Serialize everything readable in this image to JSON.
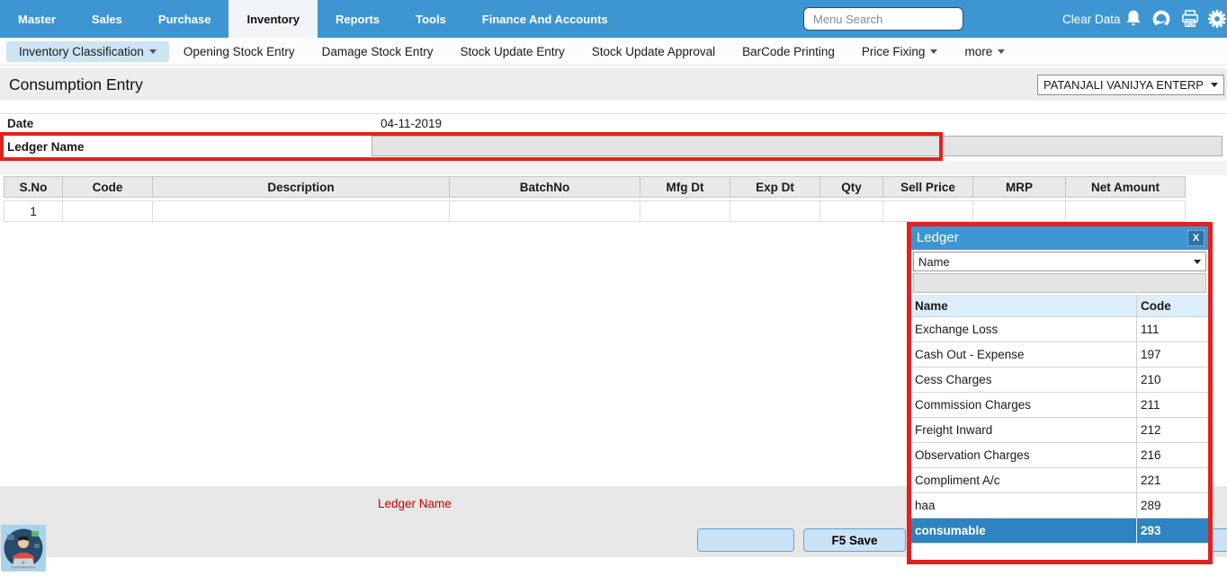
{
  "topnav": {
    "items": [
      {
        "label": "Master"
      },
      {
        "label": "Sales"
      },
      {
        "label": "Purchase"
      },
      {
        "label": "Inventory"
      },
      {
        "label": "Reports"
      },
      {
        "label": "Tools"
      },
      {
        "label": "Finance And Accounts"
      }
    ],
    "active_item": "Inventory",
    "search_placeholder": "Menu Search",
    "clear_data_label": "Clear Data",
    "icons": [
      "bell-icon",
      "support-icon",
      "printer-icon",
      "gear-icon"
    ]
  },
  "subnav": {
    "items": [
      {
        "label": "Inventory Classification",
        "has_dropdown": true,
        "active": true
      },
      {
        "label": "Opening Stock Entry"
      },
      {
        "label": "Damage Stock Entry"
      },
      {
        "label": "Stock Update Entry"
      },
      {
        "label": "Stock Update Approval"
      },
      {
        "label": "BarCode Printing"
      },
      {
        "label": "Price Fixing",
        "has_dropdown": true
      },
      {
        "label": "more",
        "has_dropdown": true
      }
    ]
  },
  "header": {
    "title": "Consumption Entry",
    "company_selector": "PATANJALI VANIJYA ENTERP"
  },
  "form": {
    "date_label": "Date",
    "date_value": "04-11-2019",
    "ledger_label": "Ledger Name",
    "ledger_value": ""
  },
  "entry_table": {
    "columns": [
      "S.No",
      "Code",
      "Description",
      "BatchNo",
      "Mfg Dt",
      "Exp Dt",
      "Qty",
      "Sell Price",
      "MRP",
      "Net Amount"
    ],
    "rows": [
      {
        "sno": "1",
        "code": "",
        "description": "",
        "batchno": "",
        "mfg_dt": "",
        "exp_dt": "",
        "qty": "",
        "sell_price": "",
        "mrp": "",
        "net_amount": ""
      }
    ]
  },
  "hint_bar": {
    "label": "Ledger Name"
  },
  "footer": {
    "blank_button_label": "",
    "save_button_label": "F5 Save"
  },
  "ledger_popup": {
    "title": "Ledger",
    "close_label": "X",
    "filter_field": "Name",
    "search_value": "",
    "columns": [
      "Name",
      "Code"
    ],
    "rows": [
      {
        "name": "Exchange Loss",
        "code": "111"
      },
      {
        "name": "Cash Out - Expense",
        "code": "197"
      },
      {
        "name": "Cess Charges",
        "code": "210"
      },
      {
        "name": "Commission Charges",
        "code": "211"
      },
      {
        "name": "Freight Inward",
        "code": "212"
      },
      {
        "name": "Observation Charges",
        "code": "216"
      },
      {
        "name": "Compliment A/c",
        "code": "221"
      },
      {
        "name": "haa",
        "code": "289"
      },
      {
        "name": "consumable",
        "code": "293"
      }
    ],
    "selected_row": "consumable"
  },
  "colors": {
    "topnav_blue": "#3d96d2",
    "annotation_red": "#e02222",
    "selected_row_blue": "#2d84c0",
    "button_blue": "#cbe2f6",
    "hint_text_red": "#cc0000",
    "popup_header_blue": "#3d96d2"
  }
}
